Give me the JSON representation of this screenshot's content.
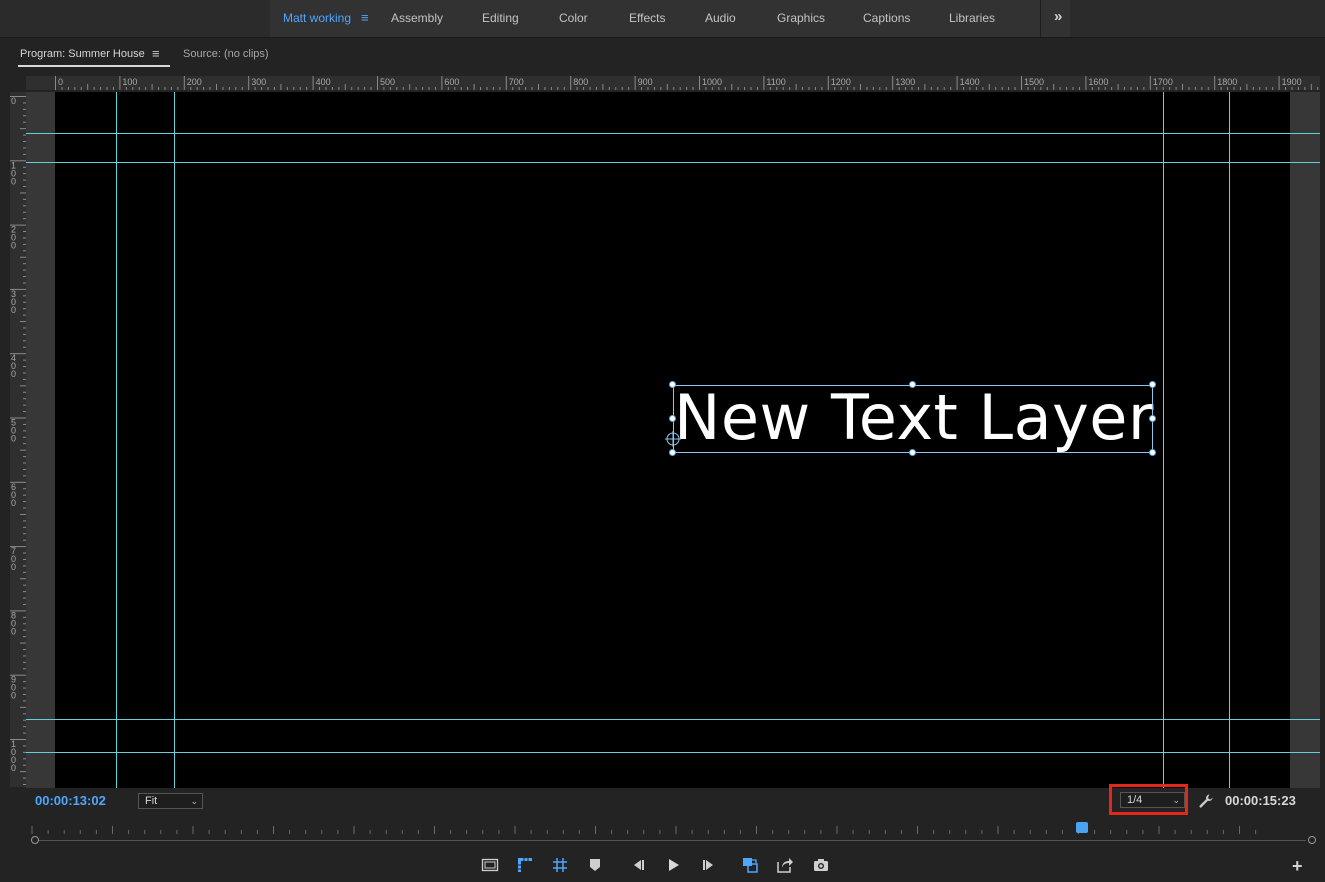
{
  "workspaces": {
    "tabs": [
      {
        "label": "Matt working",
        "active": true
      },
      {
        "label": "Assembly"
      },
      {
        "label": "Editing"
      },
      {
        "label": "Color"
      },
      {
        "label": "Effects"
      },
      {
        "label": "Audio"
      },
      {
        "label": "Graphics"
      },
      {
        "label": "Captions"
      },
      {
        "label": "Libraries"
      }
    ],
    "menu_icon": "hamburger-icon",
    "more_icon": "double-chevron-right-icon",
    "more_glyph": "»"
  },
  "panel": {
    "program_tab": "Program: Summer House",
    "source_tab": "Source: (no clips)",
    "menu_glyph": "≡"
  },
  "rulers": {
    "horizontal_labels": [
      "0",
      "100",
      "200",
      "300",
      "400",
      "500",
      "600",
      "700",
      "800",
      "900",
      "1000",
      "1100",
      "1200",
      "1300",
      "1400",
      "1500",
      "1600",
      "1700",
      "1800",
      "1900"
    ],
    "vertical_labels": [
      "0",
      "100",
      "200",
      "300",
      "400",
      "500",
      "600",
      "700",
      "800",
      "900",
      "1000"
    ]
  },
  "canvas": {
    "text_layer": "New Text Layer",
    "guide_color": "#5fd3d8",
    "selection_color": "#8fc7f0"
  },
  "footer": {
    "current_timecode": "00:00:13:02",
    "duration_timecode": "00:00:15:23",
    "zoom": {
      "selected": "Fit"
    },
    "resolution": {
      "selected": "1/4"
    },
    "settings_icon": "wrench-icon",
    "chevron_glyph": "⌄"
  },
  "controls": {
    "buttons": [
      {
        "icon": "safe-margins-icon"
      },
      {
        "icon": "rulers-toggle-icon"
      },
      {
        "icon": "guides-toggle-icon"
      },
      {
        "icon": "add-marker-icon"
      },
      {
        "icon": "step-back-icon"
      },
      {
        "icon": "play-icon"
      },
      {
        "icon": "step-forward-icon"
      },
      {
        "icon": "overwrite-icon"
      },
      {
        "icon": "export-icon"
      },
      {
        "icon": "export-frame-icon"
      }
    ],
    "add_glyph": "+"
  },
  "colors": {
    "accent": "#4fa6ff",
    "highlight": "#e3271b",
    "panel_bg": "#232323"
  }
}
